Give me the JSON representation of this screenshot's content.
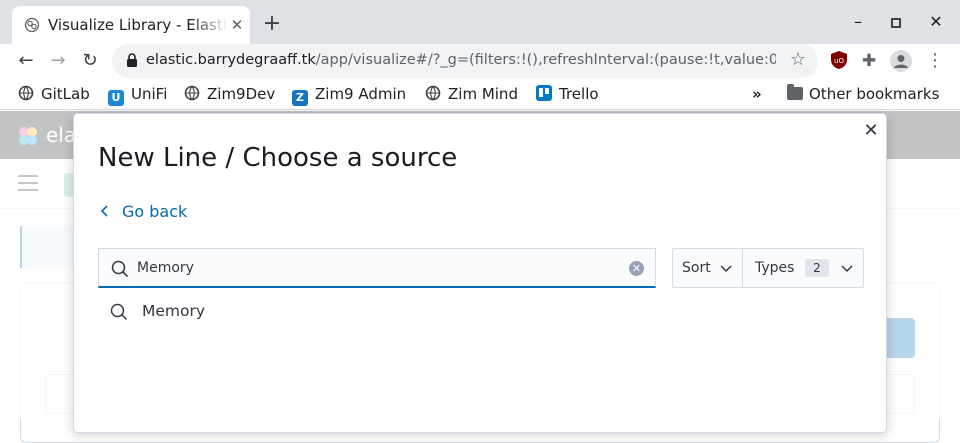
{
  "browser": {
    "tab_title": "Visualize Library - Elastic",
    "url_host": "elastic.barrydegraaff.tk",
    "url_path": "/app/visualize#/?_g=(filters:!(),refreshInterval:(pause:!t,value:0..."
  },
  "bookmarks": {
    "items": [
      {
        "label": "GitLab",
        "icon": "gitlab-icon"
      },
      {
        "label": "UniFi",
        "icon": "unifi-icon"
      },
      {
        "label": "Zim9Dev",
        "icon": "globe-icon"
      },
      {
        "label": "Zim9 Admin",
        "icon": "zimbra-icon"
      },
      {
        "label": "Zim Mind",
        "icon": "globe-icon"
      },
      {
        "label": "Trello",
        "icon": "trello-icon"
      }
    ],
    "other_label": "Other bookmarks"
  },
  "background": {
    "logo_text": "elastic"
  },
  "modal": {
    "title": "New Line / Choose a source",
    "go_back_label": "Go back",
    "search_value": "Memory",
    "sort_label": "Sort",
    "types_label": "Types",
    "types_count": "2",
    "suggestion_label": "Memory"
  },
  "colors": {
    "link": "#006bb4",
    "accent_border": "#006bb4",
    "text": "#343741"
  }
}
